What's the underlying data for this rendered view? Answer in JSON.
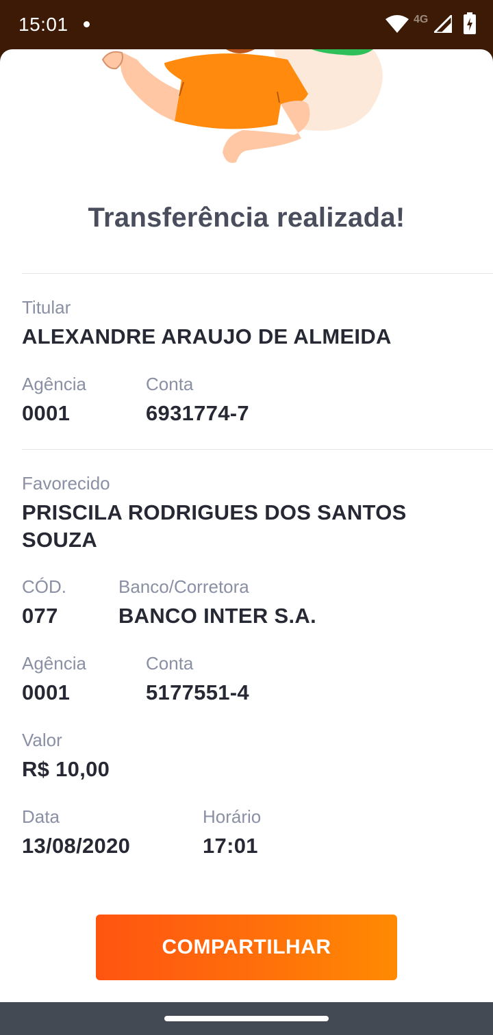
{
  "status_bar": {
    "time": "15:01",
    "network": "4G",
    "icons": [
      "notification-dot-icon",
      "wifi-icon",
      "signal-icon",
      "battery-charging-icon"
    ]
  },
  "receipt": {
    "title": "Transferência realizada!",
    "sender": {
      "holder_label": "Titular",
      "holder_name": "ALEXANDRE ARAUJO DE ALMEIDA",
      "agency_label": "Agência",
      "agency": "0001",
      "account_label": "Conta",
      "account": "6931774-7"
    },
    "recipient": {
      "payee_label": "Favorecido",
      "payee_name_line1": "PRISCILA RODRIGUES DOS SANTOS",
      "payee_name_line2": "SOUZA",
      "code_label": "CÓD.",
      "code": "077",
      "bank_label": "Banco/Corretora",
      "bank": "BANCO INTER S.A.",
      "agency_label": "Agência",
      "agency": "0001",
      "account_label": "Conta",
      "account": "5177551-4"
    },
    "amount_label": "Valor",
    "amount": "R$ 10,00",
    "date_label": "Data",
    "date": "13/08/2020",
    "time_label": "Horário",
    "time": "17:01"
  },
  "actions": {
    "share_label": "COMPARTILHAR"
  },
  "colors": {
    "accent_start": "#ff5410",
    "accent_end": "#ff8a02",
    "title": "#4a4e5c",
    "label": "#8a8fa3",
    "value": "#262833",
    "status_bar": "#3d1a05",
    "nav_bar": "#434a54"
  }
}
